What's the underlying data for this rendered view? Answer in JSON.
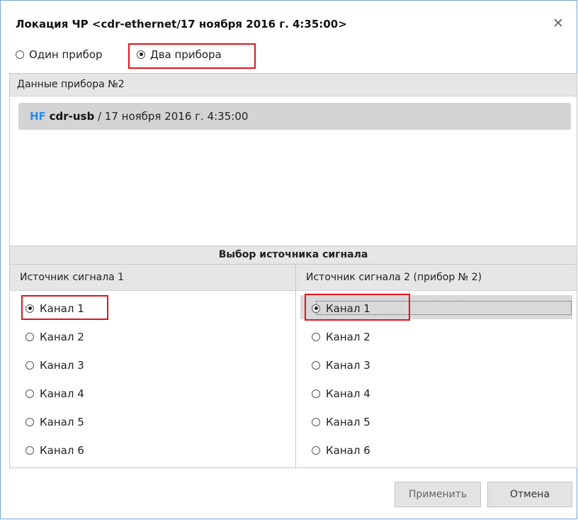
{
  "dialog": {
    "title": "Локация ЧР <cdr-ethernet/17 ноября 2016 г. 4:35:00>",
    "close_glyph": "✕"
  },
  "mode": {
    "options": [
      {
        "label": "Один прибор",
        "checked": false
      },
      {
        "label": "Два прибора",
        "checked": true
      }
    ]
  },
  "device_panel": {
    "header": "Данные прибора №2",
    "items": [
      {
        "tag": "HF",
        "name": "cdr-usb",
        "rest": " / 17 ноября 2016 г. 4:35:00"
      }
    ]
  },
  "signal_selection": {
    "title": "Выбор источника сигнала",
    "source1": {
      "header": "Источник сигнала 1",
      "channels": [
        "Канал 1",
        "Канал 2",
        "Канал 3",
        "Канал 4",
        "Канал 5",
        "Канал 6"
      ],
      "selected": "Канал 1"
    },
    "source2": {
      "header": "Источник сигнала 2 (прибор № 2)",
      "channels": [
        "Канал 1",
        "Канал 2",
        "Канал 3",
        "Канал 4",
        "Канал 5",
        "Канал 6"
      ],
      "selected": "Канал 1"
    }
  },
  "buttons": {
    "apply": "Применить",
    "cancel": "Отмена"
  },
  "colors": {
    "highlight_box": "#e0161b",
    "device_tag": "#2a8ae8"
  }
}
